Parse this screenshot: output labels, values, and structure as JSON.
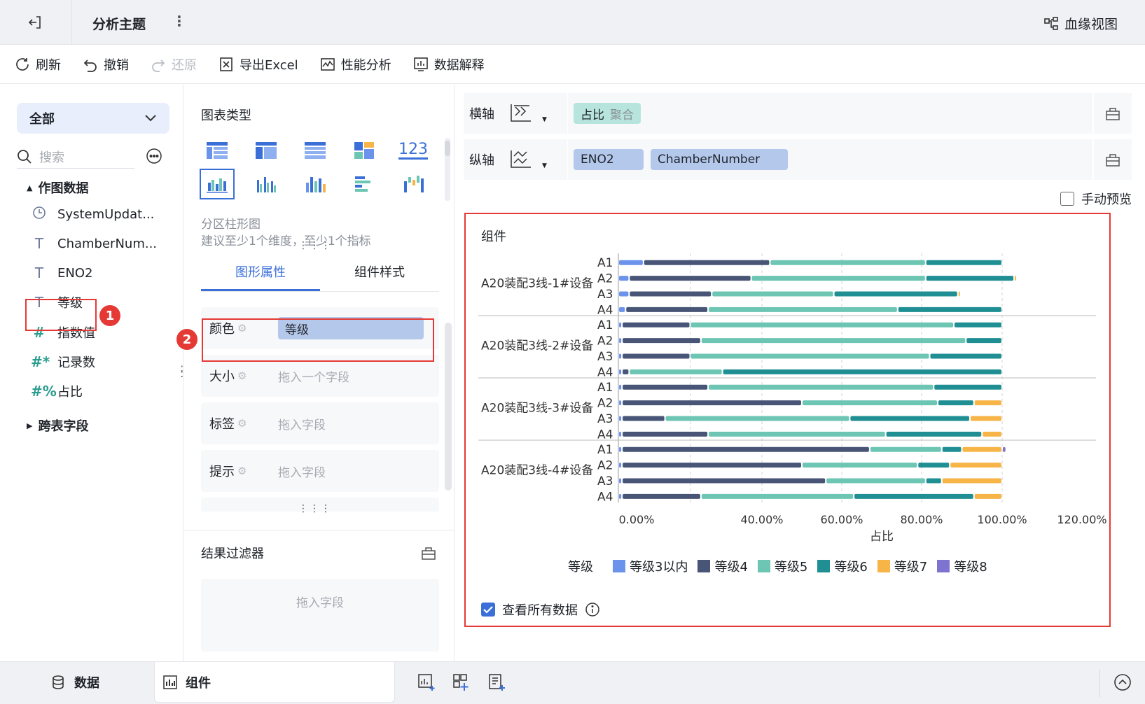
{
  "topbar": {
    "title": "分析主题",
    "more": "⋮",
    "lineage_label": "血缘视图"
  },
  "toolbar": {
    "items": [
      {
        "label": "刷新",
        "icon": "refresh-icon"
      },
      {
        "label": "撤销",
        "icon": "undo-icon"
      },
      {
        "label": "还原",
        "icon": "redo-icon",
        "disabled": true
      },
      {
        "label": "导出Excel",
        "icon": "excel-icon"
      },
      {
        "label": "性能分析",
        "icon": "performance-icon"
      },
      {
        "label": "数据解释",
        "icon": "data-explain-icon"
      }
    ]
  },
  "fields": {
    "scope": "全部",
    "search_placeholder": "搜索",
    "group1": "作图数据",
    "group2": "跨表字段",
    "items": [
      {
        "label": "SystemUpdat...",
        "type": "time"
      },
      {
        "label": "ChamberNum...",
        "type": "text"
      },
      {
        "label": "ENO2",
        "type": "text"
      },
      {
        "label": "等级",
        "type": "text"
      },
      {
        "label": "指数值",
        "type": "number"
      },
      {
        "label": "记录数",
        "type": "number"
      },
      {
        "label": "占比",
        "type": "number"
      }
    ],
    "badge1": "1"
  },
  "middle": {
    "chart_type_title": "图表类型",
    "chart_num_icon": "123",
    "chart_name": "分区柱形图",
    "chart_hint": "建议至少1个维度，至少1个指标",
    "tabs": [
      "图形属性",
      "组件样式"
    ],
    "props": [
      {
        "label": "颜色",
        "value": "等级"
      },
      {
        "label": "大小",
        "placeholder": "拖入一个字段"
      },
      {
        "label": "标签",
        "placeholder": "拖入字段"
      },
      {
        "label": "提示",
        "placeholder": "拖入字段"
      }
    ],
    "badge2": "2",
    "filter_title": "结果过滤器",
    "filter_placeholder": "拖入字段"
  },
  "axes": {
    "x_label": "横轴",
    "x_pill": "占比",
    "x_pill_sub": "聚合",
    "y_label": "纵轴",
    "y_pills": [
      "ENO2",
      "ChamberNumber"
    ],
    "manual_preview": "手动预览"
  },
  "widget": {
    "title": "组件",
    "legend_title": "等级",
    "view_all": "查看所有数据"
  },
  "colors": {
    "等级3以内": "#6b93ec",
    "等级4": "#485577",
    "等级5": "#6cc6b3",
    "等级6": "#1f8f94",
    "等级7": "#f7b548",
    "等级8": "#7f73d0"
  },
  "chart_data": {
    "type": "bar",
    "orientation": "horizontal",
    "stacked": true,
    "xlabel": "占比",
    "x_ticks": [
      "0.00%",
      "40.00%",
      "60.00%",
      "80.00%",
      "100.00%",
      "120.00%"
    ],
    "groups": [
      "A20装配3线-1#设备",
      "A20装配3线-2#设备",
      "A20装配3线-3#设备",
      "A20装配3线-4#设备"
    ],
    "categories": [
      "A1",
      "A2",
      "A3",
      "A4"
    ],
    "series_names": [
      "等级3以内",
      "等级4",
      "等级5",
      "等级6",
      "等级7",
      "等级8"
    ],
    "values": [
      [
        [
          7,
          35,
          39,
          19,
          0,
          0
        ],
        [
          3,
          34,
          44,
          22,
          0.5,
          0
        ],
        [
          3,
          23,
          32,
          31,
          0.5,
          0
        ],
        [
          2,
          23,
          49,
          26,
          0,
          0
        ]
      ],
      [
        [
          1,
          19,
          68,
          12,
          0,
          0
        ],
        [
          1,
          22,
          68,
          9,
          0,
          0
        ],
        [
          1,
          19,
          62,
          18,
          0,
          0
        ],
        [
          1,
          2,
          26,
          71,
          0,
          0
        ]
      ],
      [
        [
          1,
          24,
          58,
          17,
          0,
          0
        ],
        [
          1,
          49,
          34,
          9,
          7,
          0
        ],
        [
          1,
          12,
          49,
          30,
          8,
          0
        ],
        [
          1,
          24,
          46,
          24,
          5,
          0
        ]
      ],
      [
        [
          1,
          66,
          18,
          5,
          10,
          1
        ],
        [
          1,
          49,
          29,
          8,
          13,
          0
        ],
        [
          1,
          55,
          25,
          4,
          15,
          0
        ],
        [
          1,
          22,
          40,
          30,
          7,
          0
        ]
      ]
    ]
  },
  "bottom": {
    "tab_data": "数据",
    "tab_widget": "组件"
  }
}
